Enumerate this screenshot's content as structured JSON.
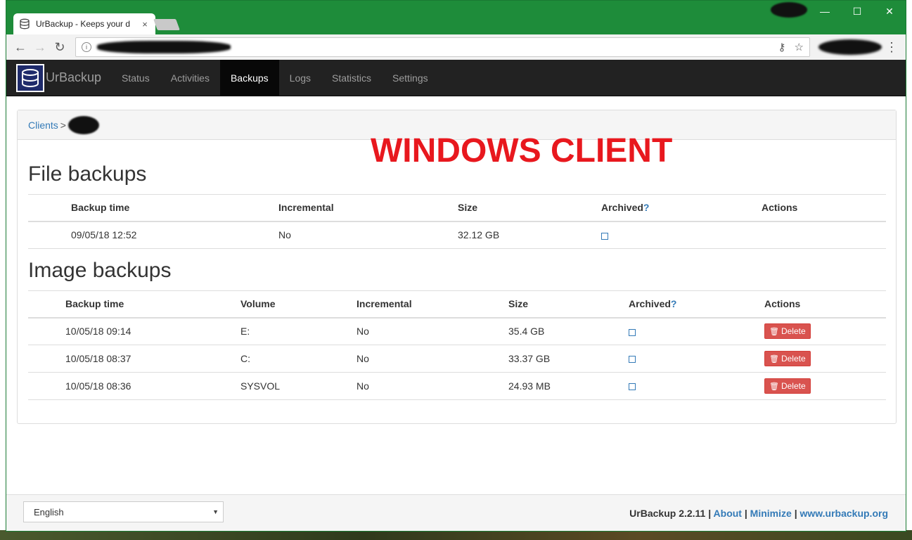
{
  "browser": {
    "tab_title": "UrBackup - Keeps your d",
    "tab_close": "×",
    "window_controls": {
      "minimize": "—",
      "maximize": "☐",
      "close": "✕"
    }
  },
  "navbar": {
    "brand": "UrBackup",
    "items": [
      {
        "label": "Status"
      },
      {
        "label": "Activities"
      },
      {
        "label": "Backups"
      },
      {
        "label": "Logs"
      },
      {
        "label": "Statistics"
      },
      {
        "label": "Settings"
      }
    ],
    "active": "Backups"
  },
  "breadcrumb": {
    "root": "Clients",
    "separator": ">"
  },
  "annotation": "WINDOWS CLIENT",
  "file_backups": {
    "title": "File backups",
    "columns": [
      "Backup time",
      "Incremental",
      "Size",
      "Archived",
      "?",
      "Actions"
    ],
    "rows": [
      {
        "time": "09/05/18 12:52",
        "incremental": "No",
        "size": "32.12 GB"
      }
    ]
  },
  "image_backups": {
    "title": "Image backups",
    "columns": [
      "Backup time",
      "Volume",
      "Incremental",
      "Size",
      "Archived",
      "?",
      "Actions"
    ],
    "delete_label": "Delete",
    "rows": [
      {
        "time": "10/05/18 09:14",
        "volume": "E:",
        "incremental": "No",
        "size": "35.4 GB"
      },
      {
        "time": "10/05/18 08:37",
        "volume": "C:",
        "incremental": "No",
        "size": "33.37 GB"
      },
      {
        "time": "10/05/18 08:36",
        "volume": "SYSVOL",
        "incremental": "No",
        "size": "24.93 MB"
      }
    ]
  },
  "footer": {
    "language": "English",
    "version": "UrBackup 2.2.11",
    "separator": "|",
    "about": "About",
    "minimize": "Minimize",
    "website": "www.urbackup.org"
  },
  "colors": {
    "accent": "#337ab7",
    "danger": "#d9534f",
    "annotation": "#e8181e",
    "window_frame": "#1e8c3a",
    "navbar": "#222222"
  },
  "icons": [
    "database-icon",
    "back-arrow-icon",
    "forward-arrow-icon",
    "reload-icon",
    "info-icon",
    "key-icon",
    "star-icon",
    "menu-dots-icon",
    "trash-icon",
    "checkbox-icon"
  ]
}
